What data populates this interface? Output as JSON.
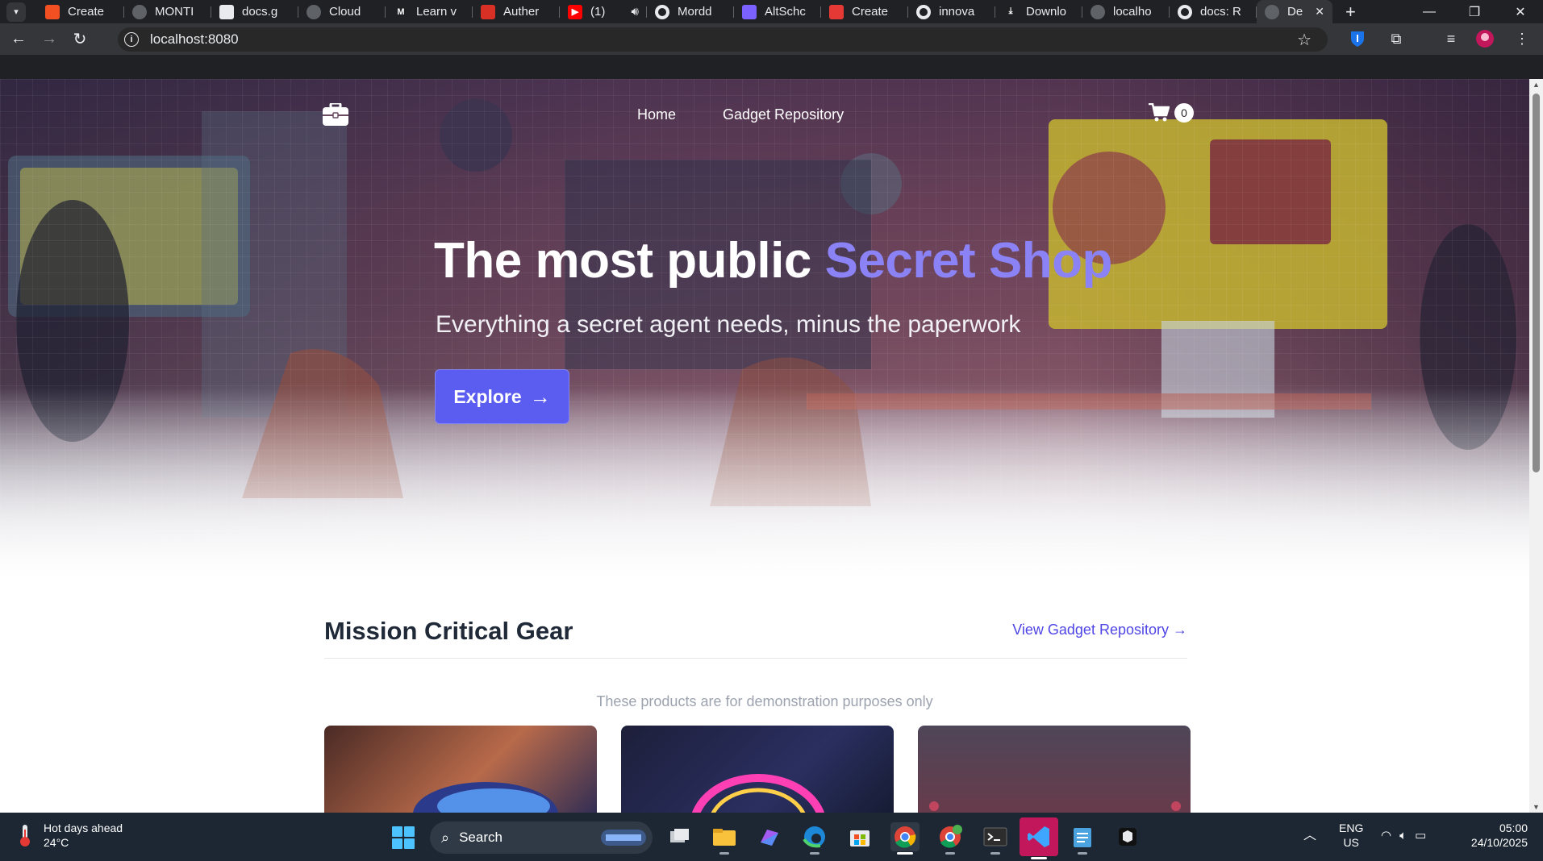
{
  "browser": {
    "tabs": [
      {
        "title": "Create",
        "icon": "microsoft-icon",
        "color": "#f25022"
      },
      {
        "title": "MONTI",
        "icon": "globe-icon",
        "color": "#5f6368"
      },
      {
        "title": "docs.g",
        "icon": "doc-icon",
        "color": "#e8eaed"
      },
      {
        "title": "Cloud",
        "icon": "openai-icon",
        "color": "#5f6368"
      },
      {
        "title": "Learn v",
        "icon": "medium-icon",
        "color": "#202124"
      },
      {
        "title": "Auther",
        "icon": "mascot-icon",
        "color": "#d93025"
      },
      {
        "title": "(1)",
        "icon": "youtube-icon",
        "color": "#ff0000"
      },
      {
        "title": "Mordd",
        "icon": "github-icon",
        "color": "#e8eaed"
      },
      {
        "title": "AltSchc",
        "icon": "altschool-icon",
        "color": "#7b61ff"
      },
      {
        "title": "Create",
        "icon": "form-icon",
        "color": "#e53935"
      },
      {
        "title": "innova",
        "icon": "github-icon",
        "color": "#e8eaed"
      },
      {
        "title": "Downlo",
        "icon": "download-icon",
        "color": "#e8eaed"
      },
      {
        "title": "localho",
        "icon": "globe-icon",
        "color": "#5f6368"
      },
      {
        "title": "docs: R",
        "icon": "github-icon",
        "color": "#e8eaed"
      },
      {
        "title": "De",
        "icon": "globe-icon",
        "color": "#5f6368",
        "active": true
      }
    ],
    "url": "localhost:8080"
  },
  "site": {
    "nav": {
      "home": "Home",
      "repository": "Gadget Repository",
      "cart_count": "0"
    },
    "hero": {
      "title_main": "The most public ",
      "title_accent": "Secret Shop",
      "subtitle": "Everything a secret agent needs, minus the paperwork",
      "cta": "Explore"
    },
    "section": {
      "title": "Mission Critical Gear",
      "view_link": "View Gadget Repository",
      "disclaimer": "These products are for demonstration purposes only"
    },
    "colors": {
      "accent": "#8b82f6",
      "button": "#5b5cf0",
      "link": "#4f46e5"
    }
  },
  "taskbar": {
    "weather_title": "Hot days ahead",
    "weather_temp": "24°C",
    "search_placeholder": "Search",
    "lang_1": "ENG",
    "lang_2": "US",
    "time": "05:00",
    "date": "24/10/2025"
  }
}
